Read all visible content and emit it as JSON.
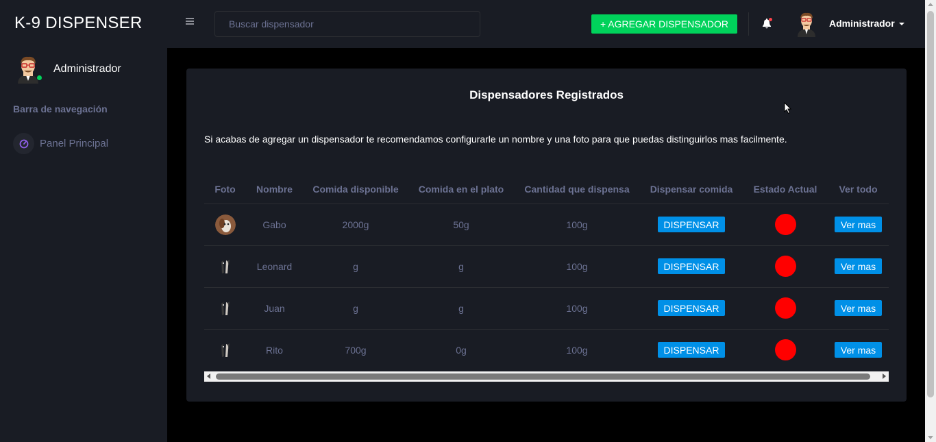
{
  "brand": "K-9 DISPENSER",
  "sidebar": {
    "profile_name": "Administrador",
    "nav_heading": "Barra de navegación",
    "items": [
      {
        "label": "Panel Principal",
        "icon": "speedometer-icon"
      }
    ]
  },
  "topbar": {
    "search_placeholder": "Buscar dispensador",
    "add_button": "+ AGREGAR DISPENSADOR",
    "user_name": "Administrador"
  },
  "card": {
    "title": "Dispensadores Registrados",
    "description": "Si acabas de agregar un dispensador te recomendamos configurarle un nombre y una foto para que puedas distinguirlos mas facilmente.",
    "columns": [
      "Foto",
      "Nombre",
      "Comida disponible",
      "Comida en el plato",
      "Cantidad que dispensa",
      "Dispensar comida",
      "Estado Actual",
      "Ver todo"
    ],
    "rows": [
      {
        "name": "Gabo",
        "available": "2000g",
        "plate": "50g",
        "amount": "100g",
        "dispense": "DISPENSAR",
        "more": "Ver mas"
      },
      {
        "name": "Leonard",
        "available": "g",
        "plate": "g",
        "amount": "100g",
        "dispense": "DISPENSAR",
        "more": "Ver mas"
      },
      {
        "name": "Juan",
        "available": "g",
        "plate": "g",
        "amount": "100g",
        "dispense": "DISPENSAR",
        "more": "Ver mas"
      },
      {
        "name": "Rito",
        "available": "700g",
        "plate": "0g",
        "amount": "100g",
        "dispense": "DISPENSAR",
        "more": "Ver mas"
      }
    ]
  },
  "colors": {
    "sidebar_bg": "#191c24",
    "success": "#00d25b",
    "primary": "#0090e7",
    "status_red": "#ff0000",
    "muted_text": "#6c7293"
  }
}
